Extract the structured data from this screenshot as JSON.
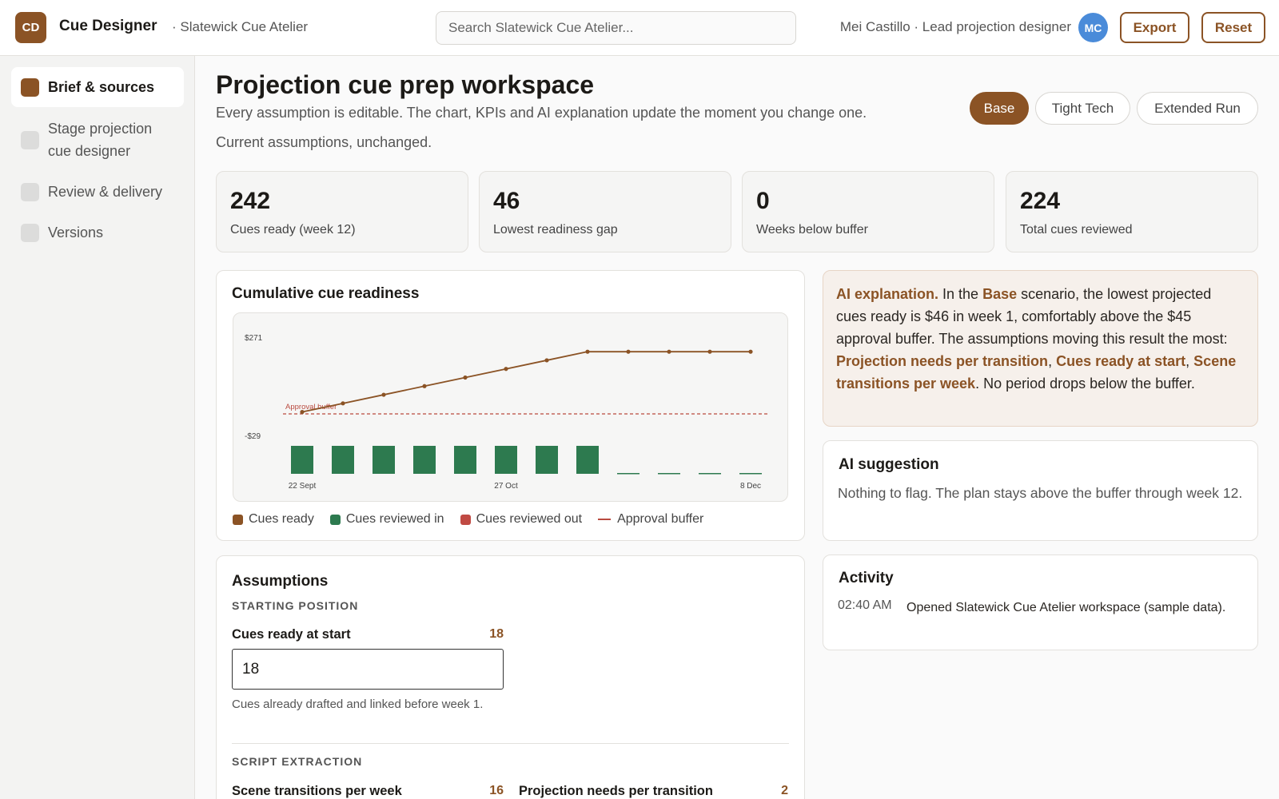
{
  "app": {
    "logo_initials": "CD",
    "name": "Cue Designer",
    "workspace": "· Slatewick Cue Atelier",
    "search_placeholder": "Search Slatewick Cue Atelier...",
    "user": "Mei Castillo · Lead projection designer",
    "avatar_initials": "MC",
    "export_label": "Export",
    "reset_label": "Reset"
  },
  "sidebar": {
    "items": [
      {
        "label": "Brief & sources",
        "active": true
      },
      {
        "label": "Stage projection cue designer",
        "active": false
      },
      {
        "label": "Review & delivery",
        "active": false
      },
      {
        "label": "Versions",
        "active": false
      }
    ]
  },
  "header": {
    "title": "Projection cue prep workspace",
    "subtitle": "Every assumption is editable. The chart, KPIs and AI explanation update the moment you change one.",
    "scenario_note": "Current assumptions, unchanged.",
    "scenarios": [
      {
        "label": "Base",
        "active": true
      },
      {
        "label": "Tight Tech",
        "active": false
      },
      {
        "label": "Extended Run",
        "active": false
      }
    ]
  },
  "kpis": [
    {
      "value": "242",
      "label": "Cues ready (week 12)"
    },
    {
      "value": "46",
      "label": "Lowest readiness gap"
    },
    {
      "value": "0",
      "label": "Weeks below buffer"
    },
    {
      "value": "224",
      "label": "Total cues reviewed"
    }
  ],
  "chart_card": {
    "title": "Cumulative cue readiness",
    "legend": [
      "Cues ready",
      "Cues reviewed in",
      "Cues reviewed out",
      "Approval buffer"
    ]
  },
  "chart_data": {
    "type": "bar",
    "title": "Cumulative cue readiness",
    "x": [
      "22 Sept",
      "29 Sept",
      "6 Oct",
      "13 Oct",
      "20 Oct",
      "27 Oct",
      "3 Nov",
      "10 Nov",
      "17 Nov",
      "24 Nov",
      "1 Dec",
      "8 Dec"
    ],
    "x_tick_labels": [
      "22 Sept",
      "27 Oct",
      "8 Dec"
    ],
    "y_tick_labels": [
      "$271",
      "-$29"
    ],
    "ylim": [
      -29,
      271
    ],
    "series": [
      {
        "name": "Cues ready",
        "type": "line",
        "values": [
          46,
          74,
          102,
          130,
          158,
          186,
          214,
          242,
          242,
          242,
          242,
          242
        ]
      },
      {
        "name": "Cues reviewed in",
        "type": "bar",
        "values": [
          28,
          28,
          28,
          28,
          28,
          28,
          28,
          28,
          0,
          0,
          0,
          0
        ]
      },
      {
        "name": "Cues reviewed out",
        "type": "bar",
        "values": [
          0,
          0,
          0,
          0,
          0,
          0,
          0,
          0,
          0,
          0,
          0,
          0
        ]
      }
    ],
    "annotations": [
      {
        "label": "Approval buffer",
        "type": "hline",
        "y": 45
      }
    ],
    "colors": {
      "line": "#8b5325",
      "bar_in": "#2d7a4f",
      "bar_out": "#c04a43",
      "buffer": "#b94a3f"
    }
  },
  "ai_explanation": {
    "lead": "AI explanation.",
    "t1": " In the ",
    "scenario": "Base",
    "t2": " scenario, the lowest projected cues ready is $46 in week 1, comfortably above the $45 approval buffer. The assumptions moving this result the most: ",
    "driver1": "Projection needs per transition",
    "sep1": ", ",
    "driver2": "Cues ready at start",
    "sep2": ", ",
    "driver3": "Scene transitions per week",
    "t3": ". No period drops below the buffer."
  },
  "ai_suggestion": {
    "title": "AI suggestion",
    "text": "Nothing to flag. The plan stays above the buffer through week 12."
  },
  "activity": {
    "title": "Activity",
    "items": [
      {
        "time": "02:40 AM",
        "text": "Opened Slatewick Cue Atelier workspace (sample data)."
      }
    ]
  },
  "assumptions": {
    "title": "Assumptions",
    "starting_section": "STARTING POSITION",
    "cues_ready_label": "Cues ready at start",
    "cues_ready_value": "18",
    "cues_ready_input": "18",
    "cues_ready_help": "Cues already drafted and linked before week 1.",
    "script_section": "SCRIPT EXTRACTION",
    "transitions_label": "Scene transitions per week",
    "transitions_value": "16",
    "needs_label": "Projection needs per transition",
    "needs_value": "2"
  },
  "colors": {
    "accent": "#8b5325",
    "avatar": "#4a8bd9"
  }
}
